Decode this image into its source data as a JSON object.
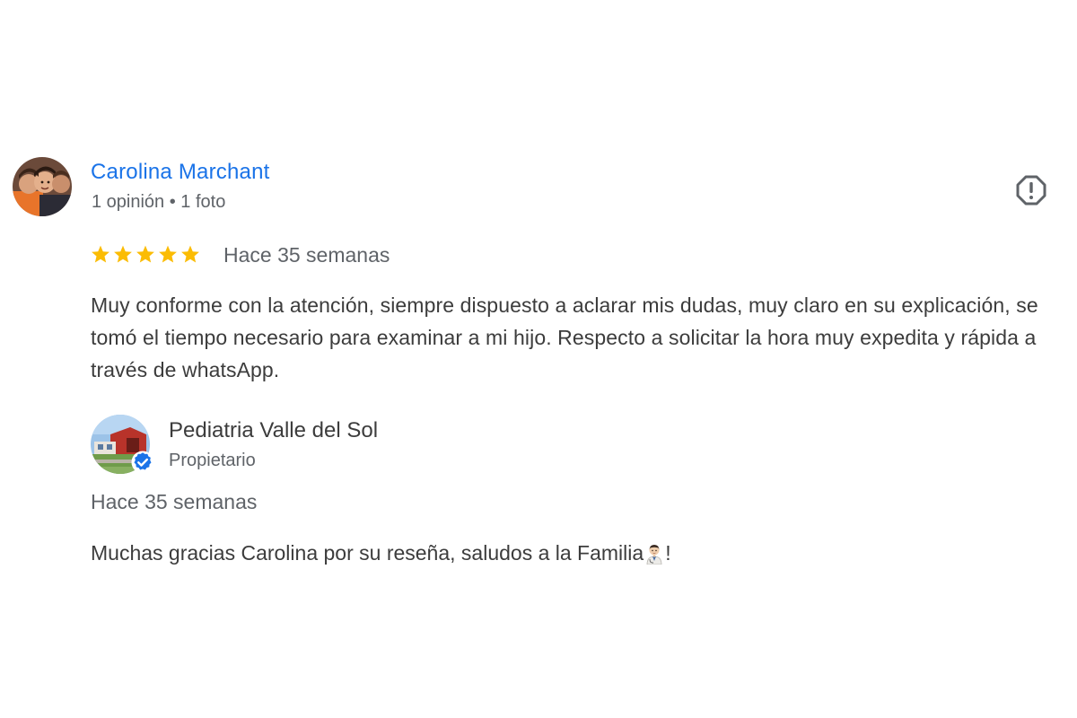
{
  "review": {
    "reviewer_name": "Carolina Marchant",
    "reviewer_meta": "1 opinión • 1 foto",
    "rating": 5,
    "rating_max": 5,
    "star_color": "#fbbc04",
    "date": "Hace 35 semanas",
    "text": "Muy conforme con la atención, siempre dispuesto a aclarar mis dudas, muy claro en su explicación, se tomó el tiempo necesario para examinar a mi hijo. Respecto a solicitar la hora muy expedita y rápida a través de whatsApp.",
    "avatar_icon": "user-photo-avatar",
    "report_icon": "report-icon"
  },
  "owner_reply": {
    "name": "Pediatria Valle del Sol",
    "role": "Propietario",
    "date": "Hace 35 semanas",
    "text_before_emoji": "Muchas gracias Carolina por su reseña, saludos a la Familia",
    "emoji_icon": "doctor-emoji-icon",
    "text_after_emoji": "!",
    "verified_icon": "verified-check-icon",
    "verified_color": "#1a73e8"
  },
  "colors": {
    "link_blue": "#1a73e8",
    "secondary_text": "#5f6368",
    "primary_text": "#3c3c3c"
  }
}
